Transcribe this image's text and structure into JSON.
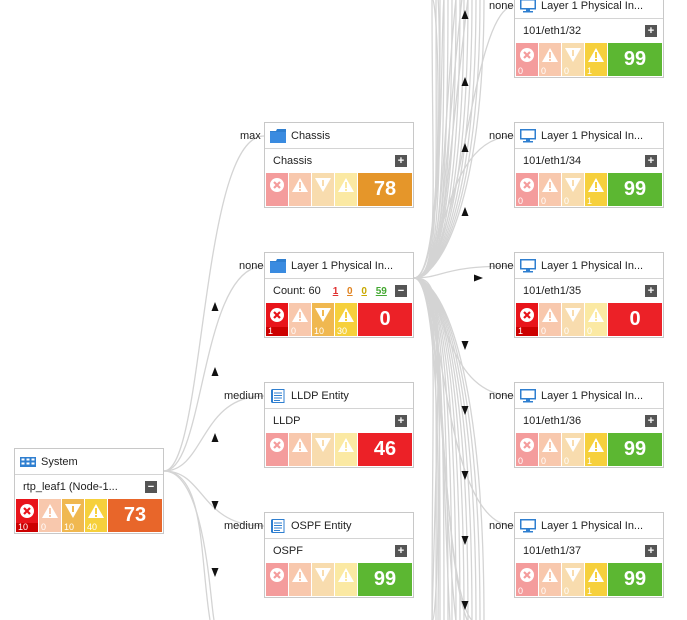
{
  "colors": {
    "crit": "#e8141a",
    "crit_dim": "#f49c9c",
    "major": "#f0a070",
    "major_dim": "#f8c8ad",
    "minor": "#f0b850",
    "minor_dim": "#f8dcae",
    "warn": "#f6d03c",
    "warn_dim": "#fbe9a3",
    "score_orange": "#e5962a",
    "score_red": "#ec2127",
    "score_green": "#5cb732",
    "score_darkorange": "#e8662a"
  },
  "edge_labels": {
    "chassis": "max",
    "layer1": "none",
    "lldp": "medium",
    "ospf": "medium",
    "p32": "none",
    "p34": "none",
    "p35": "none",
    "p36": "none",
    "p37": "none"
  },
  "nodes": {
    "system": {
      "title": "System",
      "sub": "rtp_leaf1 (Node-1...",
      "toggle": "−",
      "icon": "grid-icon",
      "counts": [
        "10",
        "0",
        "10",
        "40"
      ],
      "score": "73"
    },
    "chassis": {
      "title": "Chassis",
      "sub": "Chassis",
      "toggle": "+",
      "icon": "folder-icon",
      "counts": [
        "",
        "",
        "",
        ""
      ],
      "score": "78"
    },
    "layer1": {
      "title": "Layer 1 Physical In...",
      "count_label": "Count: 60",
      "count_vals": [
        "1",
        "0",
        "0",
        "59"
      ],
      "toggle": "−",
      "icon": "folder-icon",
      "counts": [
        "1",
        "0",
        "10",
        "30"
      ],
      "score": "0"
    },
    "lldp": {
      "title": "LLDP Entity",
      "sub": "LLDP",
      "toggle": "+",
      "icon": "document-icon",
      "counts": [
        "",
        "",
        "",
        ""
      ],
      "score": "46"
    },
    "ospf": {
      "title": "OSPF Entity",
      "sub": "OSPF",
      "toggle": "+",
      "icon": "document-icon",
      "counts": [
        "",
        "",
        "",
        ""
      ],
      "score": "99"
    },
    "p32": {
      "title": "Layer 1 Physical In...",
      "sub": "101/eth1/32",
      "toggle": "+",
      "icon": "monitor-icon",
      "counts": [
        "0",
        "0",
        "0",
        "1"
      ],
      "score": "99"
    },
    "p34": {
      "title": "Layer 1 Physical In...",
      "sub": "101/eth1/34",
      "toggle": "+",
      "icon": "monitor-icon",
      "counts": [
        "0",
        "0",
        "0",
        "1"
      ],
      "score": "99"
    },
    "p35": {
      "title": "Layer 1 Physical In...",
      "sub": "101/eth1/35",
      "toggle": "+",
      "icon": "monitor-icon",
      "counts": [
        "1",
        "0",
        "0",
        "0"
      ],
      "score": "0"
    },
    "p36": {
      "title": "Layer 1 Physical In...",
      "sub": "101/eth1/36",
      "toggle": "+",
      "icon": "monitor-icon",
      "counts": [
        "0",
        "0",
        "0",
        "1"
      ],
      "score": "99"
    },
    "p37": {
      "title": "Layer 1 Physical In...",
      "sub": "101/eth1/37",
      "toggle": "+",
      "icon": "monitor-icon",
      "counts": [
        "0",
        "0",
        "0",
        "1"
      ],
      "score": "99"
    }
  }
}
